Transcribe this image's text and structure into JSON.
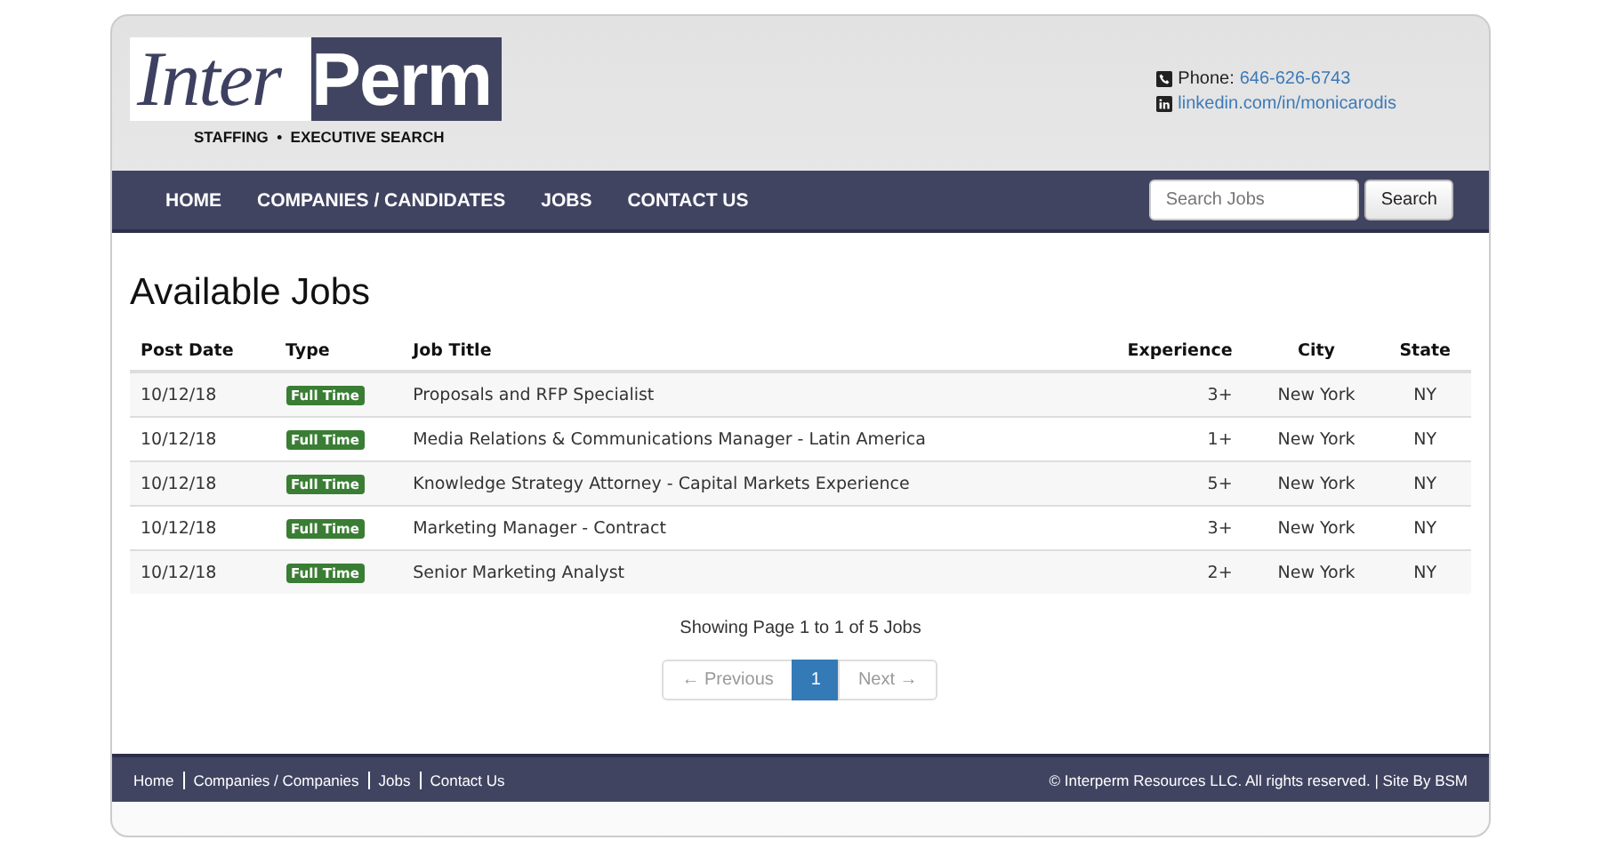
{
  "logo": {
    "part1": "Inter",
    "part2": "Perm",
    "tagline": "STAFFING  •  EXECUTIVE SEARCH"
  },
  "contact": {
    "phone_label": "Phone:",
    "phone": "646-626-6743",
    "linkedin": "linkedin.com/in/monicarodis"
  },
  "nav": {
    "items": [
      "HOME",
      "COMPANIES / CANDIDATES",
      "JOBS",
      "CONTACT US"
    ],
    "search": {
      "placeholder": "Search Jobs",
      "button": "Search"
    }
  },
  "heading": "Available Jobs",
  "table": {
    "columns": [
      "Post Date",
      "Type",
      "Job Title",
      "Experience",
      "City",
      "State"
    ],
    "rows": [
      {
        "date": "10/12/18",
        "type": "Full Time",
        "title": "Proposals and RFP Specialist",
        "experience": "3+",
        "city": "New York",
        "state": "NY"
      },
      {
        "date": "10/12/18",
        "type": "Full Time",
        "title": "Media Relations & Communications Manager - Latin America",
        "experience": "1+",
        "city": "New York",
        "state": "NY"
      },
      {
        "date": "10/12/18",
        "type": "Full Time",
        "title": "Knowledge Strategy Attorney - Capital Markets Experience",
        "experience": "5+",
        "city": "New York",
        "state": "NY"
      },
      {
        "date": "10/12/18",
        "type": "Full Time",
        "title": "Marketing Manager - Contract",
        "experience": "3+",
        "city": "New York",
        "state": "NY"
      },
      {
        "date": "10/12/18",
        "type": "Full Time",
        "title": "Senior Marketing Analyst",
        "experience": "2+",
        "city": "New York",
        "state": "NY"
      }
    ]
  },
  "summary": "Showing Page 1 to 1 of 5 Jobs",
  "pagination": {
    "previous": "← Previous",
    "pages": [
      {
        "label": "1",
        "selected": true
      }
    ],
    "next": "Next →"
  },
  "footer": {
    "links": [
      "Home",
      "Companies / Companies",
      "Jobs",
      "Contact Us"
    ],
    "copyright": "© Interperm Resources LLC. All rights reserved. | Site By BSM"
  }
}
